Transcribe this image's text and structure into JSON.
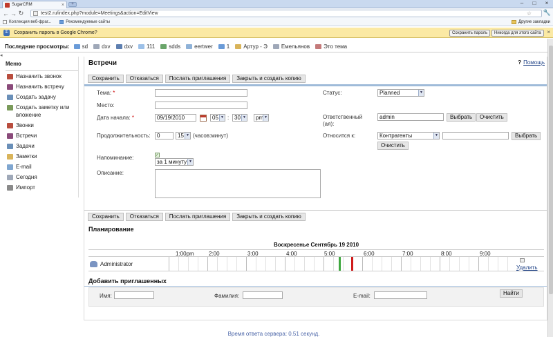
{
  "browser": {
    "tab_title": "SugarCRM",
    "url": "test2.ru/index.php?module=Meetings&action=EditView",
    "bookmarks": [
      "Коллекция веб-фраг...",
      "Рекомендуемые сайты"
    ],
    "other_bookmarks": "Другие закладки",
    "infobar": {
      "text": "Сохранить пароль в Google Chrome?",
      "save_btn": "Сохранить пароль",
      "never_btn": "Никогда для этого сайта"
    }
  },
  "last_viewed": {
    "title": "Последние просмотры:",
    "items": [
      {
        "label": "sd",
        "color": "#6a9bd8"
      },
      {
        "label": "dxv",
        "color": "#9fa8b8"
      },
      {
        "label": "dxv",
        "color": "#5e7fb0"
      },
      {
        "label": "111",
        "color": "#9cc0e8"
      },
      {
        "label": "sdds",
        "color": "#6aa56a"
      },
      {
        "label": "eertwer",
        "color": "#8fb2d8"
      },
      {
        "label": "1",
        "color": "#6a9bd8"
      },
      {
        "label": "Артур - Э",
        "color": "#d9b45a"
      },
      {
        "label": "Емельянов",
        "color": "#9fa8b8"
      },
      {
        "label": "Это тема",
        "color": "#c47a7a"
      }
    ]
  },
  "sidebar": {
    "title": "Меню",
    "items": [
      {
        "label": "Назначить звонок",
        "icon": "phone-icon",
        "color": "#b94d3e"
      },
      {
        "label": "Назначить встречу",
        "icon": "meeting-icon",
        "color": "#8a4a7a"
      },
      {
        "label": "Создать задачу",
        "icon": "task-icon",
        "color": "#6a8fb8"
      },
      {
        "label": "Создать заметку или вложение",
        "icon": "note-icon",
        "color": "#7a9a5a"
      },
      {
        "label": "Звонки",
        "icon": "calls-icon",
        "color": "#b94d3e"
      },
      {
        "label": "Встречи",
        "icon": "meetings-icon",
        "color": "#8a4a7a"
      },
      {
        "label": "Задачи",
        "icon": "tasks-icon",
        "color": "#6a8fb8"
      },
      {
        "label": "Заметки",
        "icon": "notes-icon",
        "color": "#d9b45a"
      },
      {
        "label": "E-mail",
        "icon": "email-icon",
        "color": "#7fa6d0"
      },
      {
        "label": "Сегодня",
        "icon": "calendar-icon",
        "color": "#9fa8b8"
      },
      {
        "label": "Импорт",
        "icon": "import-icon",
        "color": "#8a8a8a"
      }
    ]
  },
  "main": {
    "title": "Встречи",
    "help": "Помощь",
    "buttons": {
      "save": "Сохранить",
      "cancel": "Отказаться",
      "send_invites": "Послать приглашения",
      "close_copy": "Закрыть и создать копию"
    },
    "form": {
      "subject_label": "Тема:",
      "location_label": "Место:",
      "start_label": "Дата начала:",
      "start_date": "09/19/2010",
      "start_hour": "05",
      "start_minute": "30",
      "start_ampm": "pm",
      "duration_label": "Продолжительность:",
      "duration_hours": "0",
      "duration_minutes": "15",
      "duration_hint": "(часов:минут)",
      "reminder_label": "Напоминание:",
      "reminder_value": "за 1 минуту",
      "description_label": "Описание:",
      "status_label": "Статус:",
      "status_value": "Planned",
      "assigned_label": "Ответственный (ая):",
      "assigned_value": "admin",
      "select_btn": "Выбрать",
      "clear_btn": "Очистить",
      "related_label": "Относится к:",
      "related_type": "Контрагенты"
    },
    "scheduling": {
      "title": "Планирование",
      "date": "Воскресенье Сентябрь 19 2010",
      "hours": [
        "1:00pm",
        "2:00",
        "3:00",
        "4:00",
        "5:00",
        "6:00",
        "7:00",
        "8:00",
        "9:00"
      ],
      "user": "Administrator",
      "delete": "Удалить"
    },
    "invitees": {
      "title": "Добавить приглашенных",
      "first_name": "Имя:",
      "last_name": "Фамилия:",
      "email": "E-mail:",
      "search_btn": "Найти"
    }
  },
  "footer": "Время ответа сервера: 0.51 секунд."
}
